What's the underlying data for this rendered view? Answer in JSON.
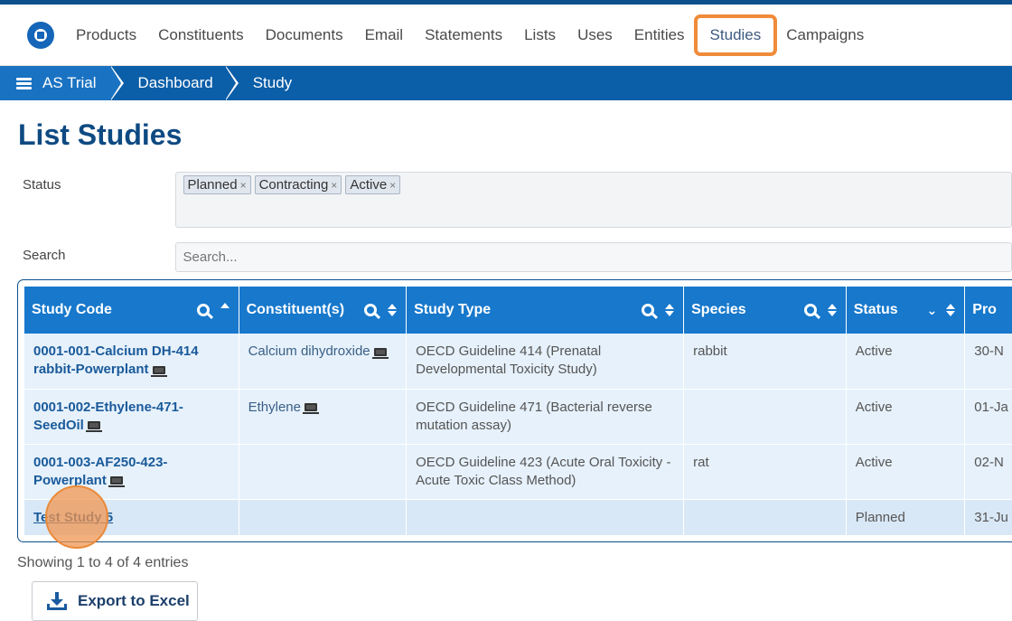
{
  "nav": {
    "items": [
      "Products",
      "Constituents",
      "Documents",
      "Email",
      "Statements",
      "Lists",
      "Uses",
      "Entities",
      "Studies",
      "Campaigns"
    ],
    "highlighted": "Studies"
  },
  "breadcrumb": [
    "AS Trial",
    "Dashboard",
    "Study"
  ],
  "page": {
    "title": "List Studies"
  },
  "filters": {
    "status_label": "Status",
    "status_tags": [
      "Planned",
      "Contracting",
      "Active"
    ],
    "search_label": "Search",
    "search_placeholder": "Search..."
  },
  "table": {
    "columns": [
      "Study Code",
      "Constituent(s)",
      "Study Type",
      "Species",
      "Status",
      "Pro"
    ],
    "rows": [
      {
        "code": "0001-001-Calcium DH-414 rabbit-Powerplant",
        "constituent": "Calcium dihydroxide",
        "type": "OECD Guideline 414 (Prenatal Developmental Toxicity Study)",
        "species": "rabbit",
        "status": "Active",
        "date": "30-N"
      },
      {
        "code": "0001-002-Ethylene-471-SeedOil",
        "constituent": "Ethylene",
        "type": "OECD Guideline 471 (Bacterial reverse mutation assay)",
        "species": "",
        "status": "Active",
        "date": "01-Ja"
      },
      {
        "code": "0001-003-AF250-423-Powerplant",
        "constituent": "",
        "type": "OECD Guideline 423 (Acute Oral Toxicity - Acute Toxic Class Method)",
        "species": "rat",
        "status": "Active",
        "date": "02-N"
      },
      {
        "code": "Test Study 5",
        "constituent": "",
        "type": "",
        "species": "",
        "status": "Planned",
        "date": "31-Ju"
      }
    ]
  },
  "footer": {
    "info": "Showing 1 to 4 of 4 entries",
    "export_label": "Export to Excel"
  },
  "colors": {
    "brand": "#0b5ea8",
    "header": "#1778cc",
    "highlight": "#ef8b3a"
  }
}
